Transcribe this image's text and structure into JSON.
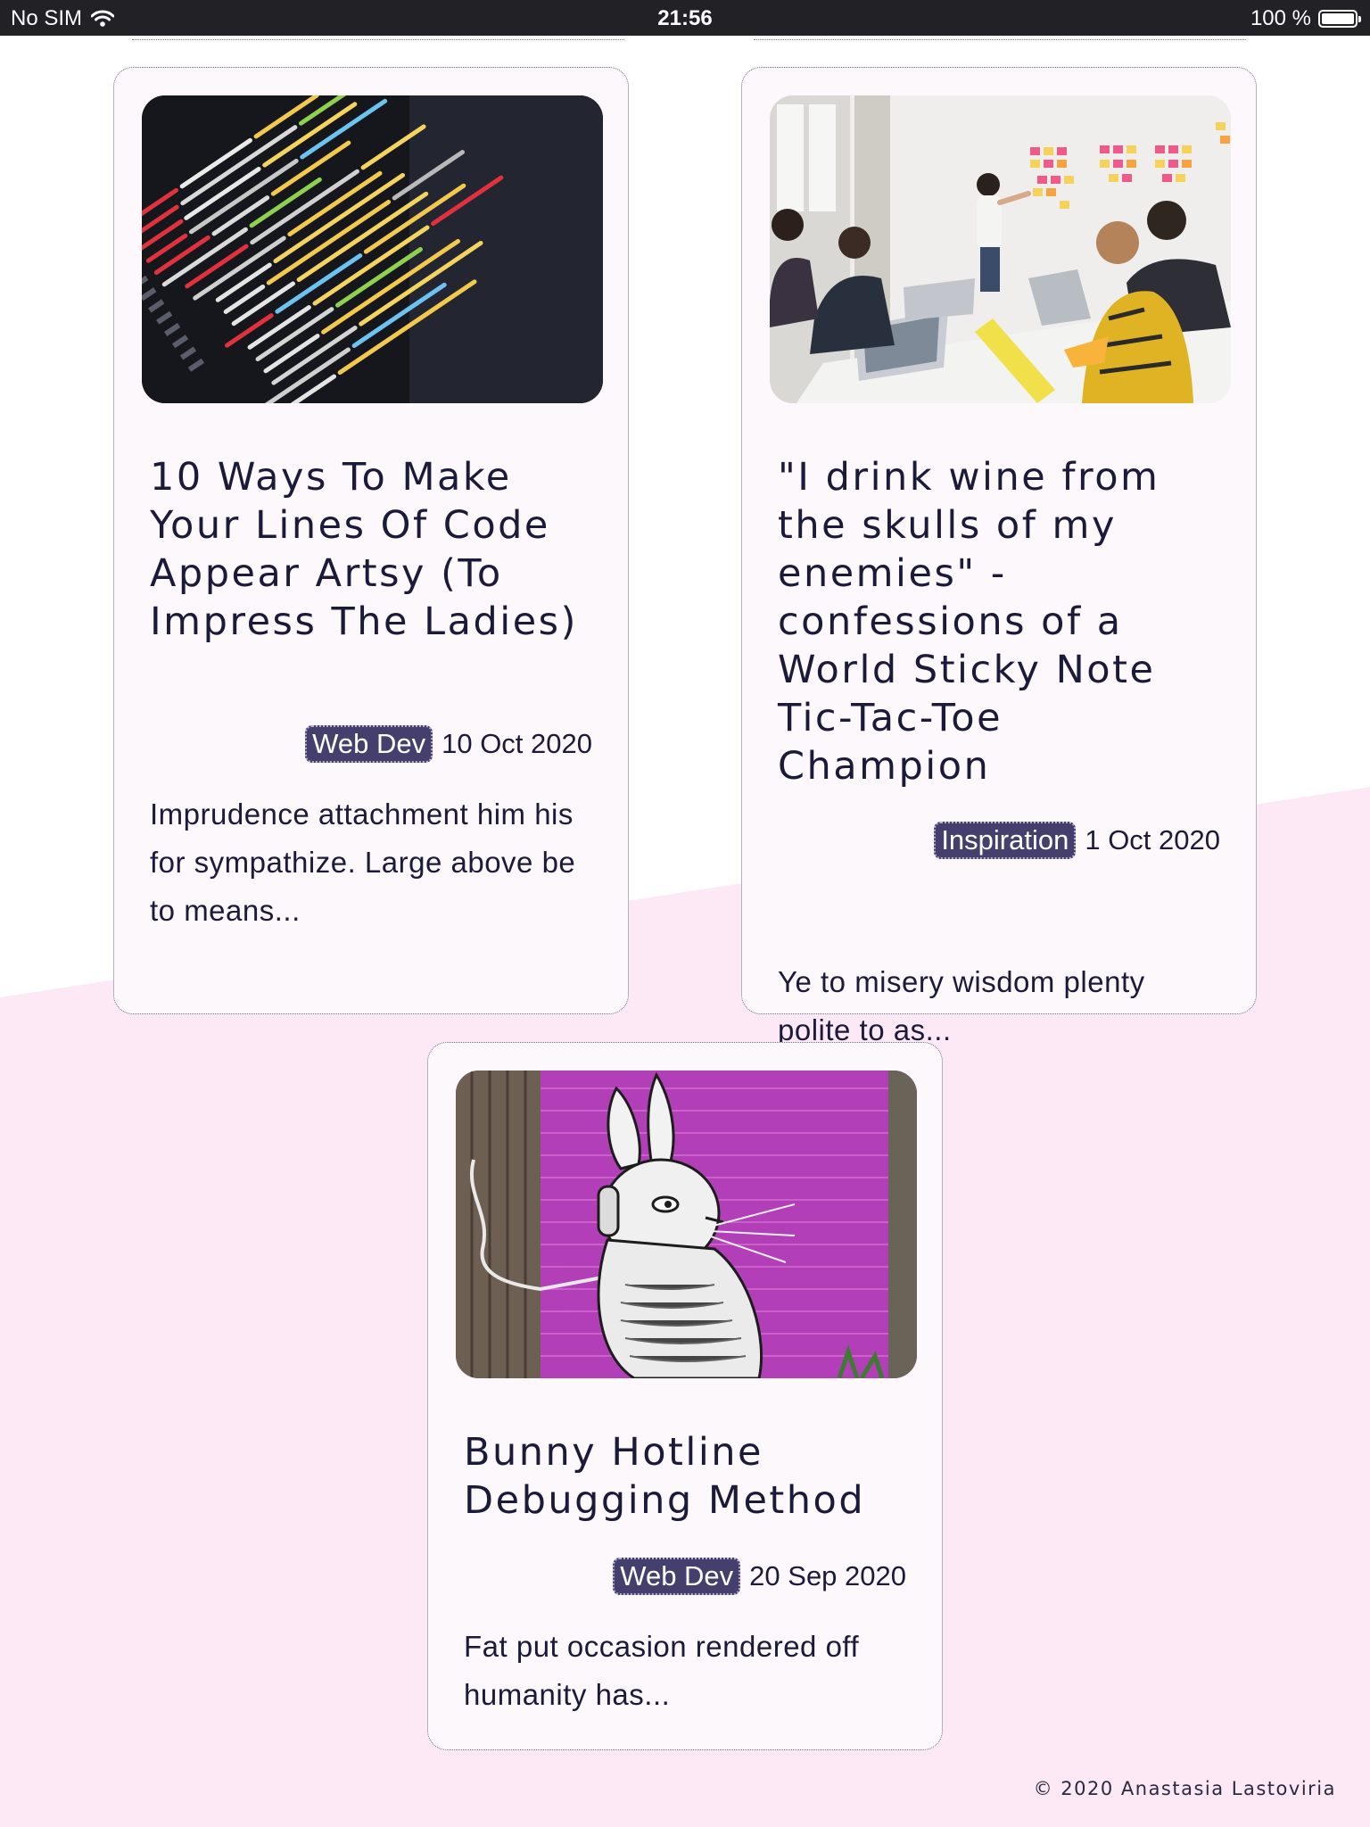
{
  "status_bar": {
    "carrier": "No SIM",
    "time": "21:56",
    "battery": "100 %"
  },
  "posts": [
    {
      "title": "10 Ways To Make Your Lines Of Code Appear Artsy (To Impress The Ladies)",
      "category": "Web Dev",
      "date": "10 Oct 2020",
      "excerpt": "Imprudence attachment him his for sympathize. Large above be to means..."
    },
    {
      "title": "\"I drink wine from the skulls of my enemies\" - confessions of a World Sticky Note Tic-Tac-Toe Champion",
      "category": "Inspiration",
      "date": "1 Oct 2020",
      "excerpt": "Ye to misery wisdom plenty polite to as..."
    },
    {
      "title": "Bunny Hotline Debugging Method",
      "category": "Web Dev",
      "date": "20 Sep 2020",
      "excerpt": "Fat put occasion rendered off humanity has..."
    }
  ],
  "footer": {
    "copyright": "© 2020 Anastasia Lastoviria"
  },
  "colors": {
    "text": "#1c1a3a",
    "tag_bg": "#453f6e",
    "card_bg": "#fdf8fc",
    "pink_bg": "#fde9f6"
  }
}
